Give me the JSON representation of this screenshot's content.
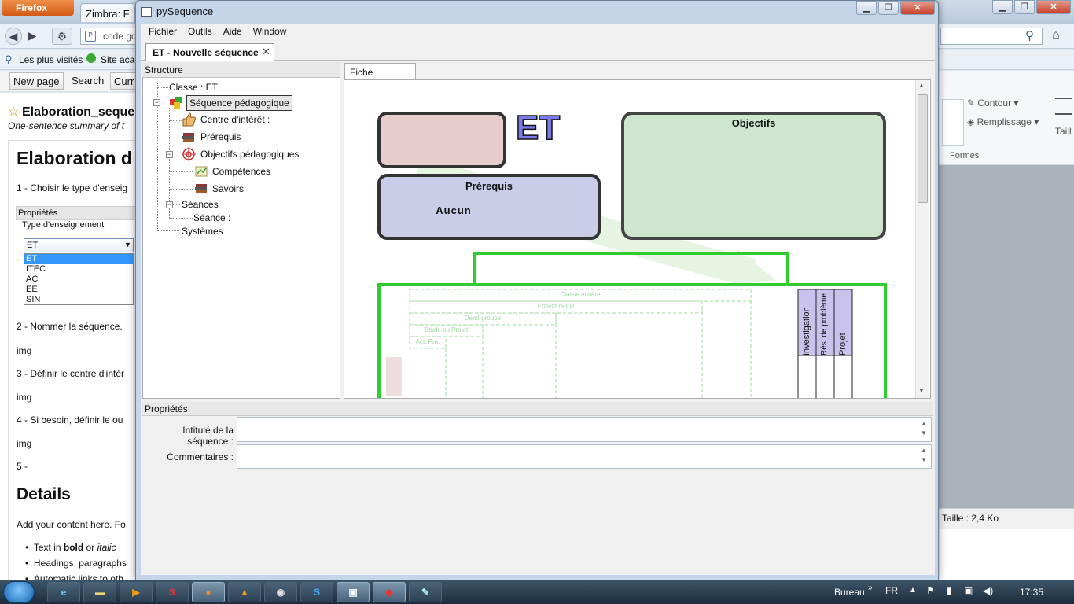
{
  "firefox": {
    "menu_button": "Firefox",
    "tab_label": "Zimbra: F",
    "url_fragment": "code.go",
    "bookmarks": [
      "Les plus visités",
      "Site acad"
    ],
    "toolbar_buttons": [
      "New page",
      "Search",
      "Curr"
    ],
    "page": {
      "title": "Elaboration_seque",
      "summary": "One-sentence summary of t",
      "heading": "Elaboration d",
      "step1": "1 - Choisir le type d'enseig",
      "props_label": "Propriétés",
      "type_label": "Type d'enseignement",
      "select_value": "ET",
      "options": [
        "ET",
        "ITEC",
        "AC",
        "EE",
        "SIN"
      ],
      "step2": "2 - Nommer la séquence.",
      "img1": "img",
      "step3": "3 - Définir le centre d'intér",
      "img2": "img",
      "step4": "4 - Si besoin, définir le ou",
      "img3": "img",
      "step5": "5 -",
      "details_heading": "Details",
      "add_content": "Add your content here. Fo",
      "bullet1_pre": "Text in ",
      "bullet1_bold": "bold",
      "bullet1_mid": " or ",
      "bullet1_italic": "italic",
      "bullet2": "Headings, paragraphs",
      "bullet3": "Automatic links to oth"
    },
    "ribbon": {
      "contour": "Contour",
      "remplissage": "Remplissage",
      "taille": "Taill",
      "formes": "Formes"
    },
    "status_size": "Taille : 2,4 Ko"
  },
  "pysequence": {
    "window_title": "pySequence",
    "menu": [
      "Fichier",
      "Outils",
      "Aide",
      "Window"
    ],
    "doc_tab": "ET - Nouvelle séquence",
    "doc_tab_close": "✕",
    "structure_header": "Structure",
    "tree": {
      "classe": "Classe :  ET",
      "sequence": "Séquence pédagogique",
      "centre": "Centre d'intérêt :",
      "prerequis": "Prérequis",
      "objectifs": "Objectifs pédagogiques",
      "competences": "Compétences",
      "savoirs": "Savoirs",
      "seances": "Séances",
      "seance": "Séance :",
      "systemes": "Systèmes"
    },
    "fiche_tab": "Fiche Séquence",
    "fiche": {
      "big_label": "ET",
      "objectifs": "Objectifs",
      "prerequis": "Prérequis",
      "prerequis_value": "Aucun",
      "rows": [
        "Classe entière",
        "Effectif réduit",
        "Demi-groupe",
        "Etude ou Projet",
        "Act. Pra."
      ],
      "columns": [
        "Investigation",
        "Rés. de problème",
        "Projet"
      ]
    },
    "props_header": "Propriétés",
    "field_intitule": "Intitulé de la séquence :",
    "field_commentaires": "Commentaires :"
  },
  "taskbar": {
    "bureau": "Bureau",
    "lang": "FR",
    "clock": "17:35"
  }
}
